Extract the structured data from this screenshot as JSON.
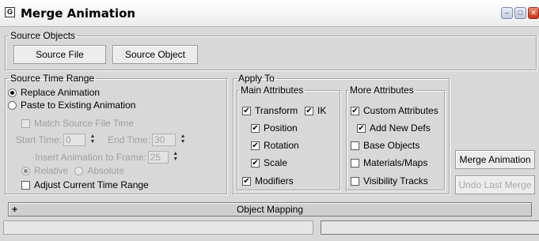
{
  "window": {
    "title": "Merge Animation",
    "icon": "3ds-max-icon"
  },
  "source_objects": {
    "legend": "Source Objects",
    "source_file_button": "Source File",
    "source_object_button": "Source Object"
  },
  "source_time_range": {
    "legend": "Source Time Range",
    "replace_animation": "Replace Animation",
    "paste_existing": "Paste to Existing Animation",
    "match_source_file_time": "Match Source File Time",
    "start_time_label": "Start Time:",
    "start_time_value": "0",
    "end_time_label": "End Time:",
    "end_time_value": "30",
    "insert_label": "Insert Animation to Frame:",
    "insert_value": "25",
    "relative": "Relative",
    "absolute": "Absolute",
    "adjust_current_time_range": "Adjust Current Time Range"
  },
  "apply_to": {
    "legend": "Apply To",
    "main_attributes": {
      "legend": "Main Attributes",
      "transform": "Transform",
      "ik": "IK",
      "position": "Position",
      "rotation": "Rotation",
      "scale": "Scale",
      "modifiers": "Modifiers"
    },
    "more_attributes": {
      "legend": "More Attributes",
      "custom_attributes": "Custom Attributes",
      "add_new_defs": "Add New Defs",
      "base_objects": "Base Objects",
      "materials_maps": "Materials/Maps",
      "visibility_tracks": "Visibility Tracks"
    }
  },
  "actions": {
    "merge_animation": "Merge Animation",
    "undo_last_merge": "Undo Last Merge"
  },
  "rollout": {
    "expand_symbol": "+",
    "label": "Object Mapping"
  },
  "check_mark": "✔",
  "colors": {
    "window_bg": "#d8d8d8",
    "close_button": "#c8331a",
    "disabled_text": "#a0a0a0"
  }
}
